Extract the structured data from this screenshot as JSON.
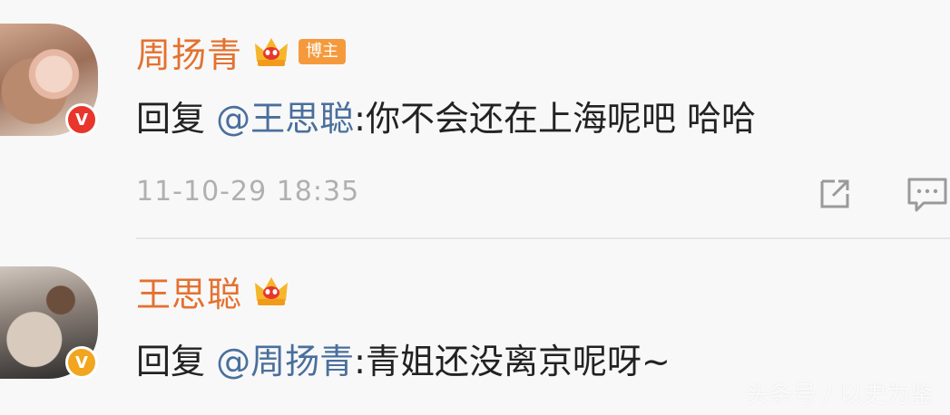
{
  "comments": [
    {
      "author": "周扬青",
      "badge": "博主",
      "verified_badge": "V",
      "reply_prefix": "回复",
      "mention": "@王思聪",
      "separator": ":",
      "text": "你不会还在上海呢吧 哈哈",
      "timestamp": "11-10-29 18:35",
      "avatar_icon": "avatar-photo",
      "verified_color": "#e8362c"
    },
    {
      "author": "王思聪",
      "verified_badge": "V",
      "reply_prefix": "回复",
      "mention": "@周扬青",
      "separator": ":",
      "text": "青姐还没离京呢呀~",
      "avatar_icon": "avatar-photo",
      "verified_color": "#f2a51f"
    }
  ],
  "icons": {
    "crown": "crown-icon",
    "share": "share-icon",
    "comment": "comment-icon"
  },
  "colors": {
    "author_name": "#e4712f",
    "mention": "#4a6f9c",
    "timestamp": "#b0b0b0",
    "badge_bg": "#f59a3c"
  },
  "watermark": "头条号 / 以史为鉴"
}
